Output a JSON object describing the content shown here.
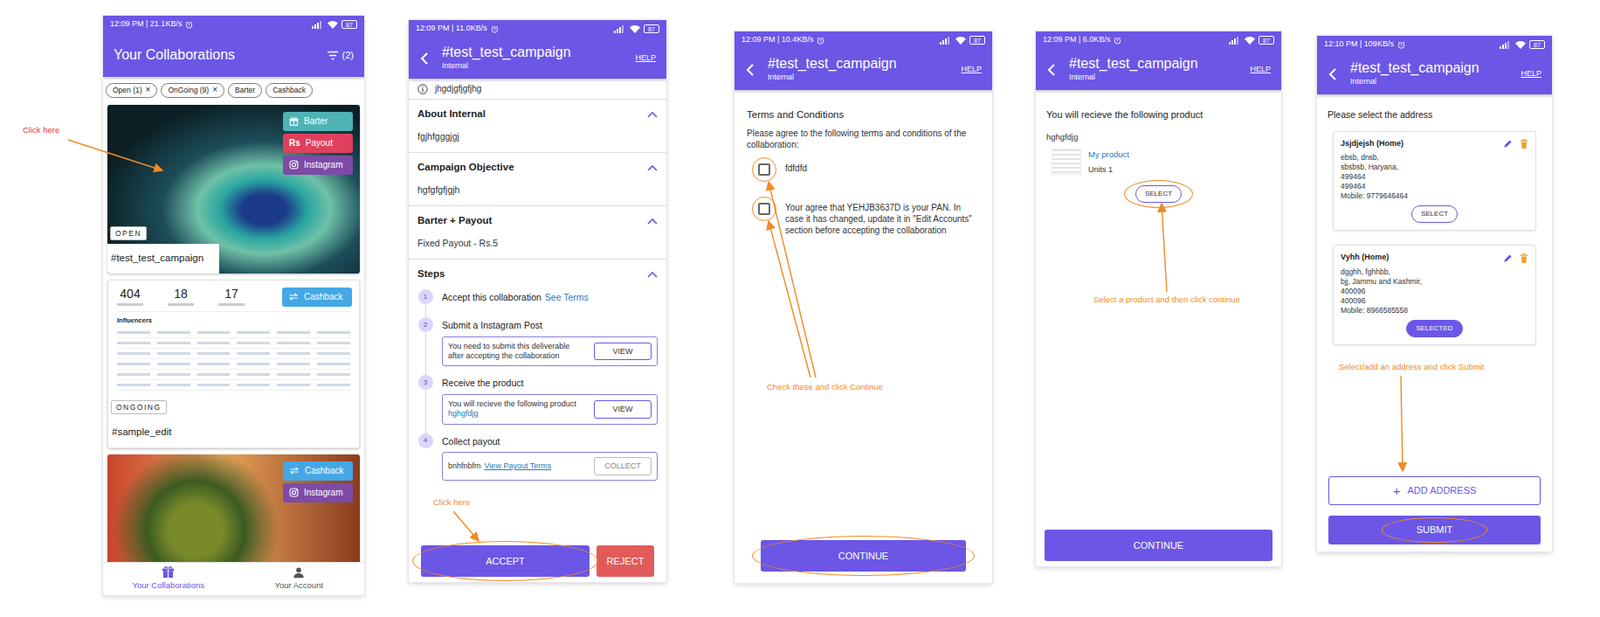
{
  "annotations": [
    {
      "text": "Click here",
      "color": "#e53935"
    },
    {
      "text": "Click here",
      "color": "#f08a24"
    },
    {
      "text": "Check these and click Continue",
      "color": "#f08a24"
    },
    {
      "text": "Select a product and then click continue",
      "color": "#f08a24"
    },
    {
      "text": "Select/add an address and click Submit",
      "color": "#f08a24"
    }
  ],
  "collaborations_screen": {
    "status_bar": {
      "time": "12:09 PM | 21.1KB/s",
      "battery": "87"
    },
    "title": "Your Collaborations",
    "filter_count": "(2)",
    "chip_remove": "×",
    "chips": [
      {
        "label": "Open (1)",
        "removable": true
      },
      {
        "label": "OnGoing (9)",
        "removable": true
      },
      {
        "label": "Barter",
        "removable": false
      },
      {
        "label": "Cashback",
        "removable": false
      }
    ],
    "cards": [
      {
        "kind": "feather-photo",
        "status": "OPEN",
        "title": "#test_test_campaign",
        "tags": [
          {
            "label": "Barter",
            "kind": "gift",
            "color": "#4fb3b5"
          },
          {
            "label": "Payout",
            "kind": "rupee",
            "glyph": "Rs",
            "color": "#e0405e"
          },
          {
            "label": "Instagram",
            "kind": "instagram",
            "color": "#7d4ba6"
          }
        ]
      },
      {
        "kind": "dashboard",
        "stats": [
          "404",
          "18",
          "17"
        ],
        "table_title": "Influencers",
        "status": "ONGOING",
        "title": "#sample_edit",
        "tags": [
          {
            "label": "Cashback",
            "kind": "cashback",
            "color": "#45a7e6"
          }
        ]
      },
      {
        "kind": "beetle-photo",
        "tags": [
          {
            "label": "Cashback",
            "kind": "cashback",
            "color": "#45a7e6"
          },
          {
            "label": "Instagram",
            "kind": "instagram",
            "color": "#7d4ba6"
          }
        ]
      }
    ],
    "nav": [
      {
        "label": "Your Collaborations",
        "selected": true
      },
      {
        "label": "Your Account",
        "selected": false
      }
    ]
  },
  "details_screen": {
    "status_bar": {
      "time": "12:09 PM | 11.0KB/s",
      "battery": "87"
    },
    "header": {
      "title": "#test_test_campaign",
      "subtitle": "Internal",
      "help": "HELP"
    },
    "info": "jhgdjgfjgfjhg",
    "sections": [
      {
        "title": "About Internal",
        "body": "fgjhfgggjgj",
        "expanded": true
      },
      {
        "title": "Campaign Objective",
        "body": "hgfgfgfjgjh",
        "expanded": true
      },
      {
        "title": "Barter + Payout",
        "body": "Fixed Payout - Rs.5",
        "expanded": true
      }
    ],
    "steps_title": "Steps",
    "steps_expanded": true,
    "steps": [
      {
        "kind": "accept",
        "number": "1",
        "title": "Accept this collaboration",
        "link": "See Terms"
      },
      {
        "kind": "deliverable",
        "number": "2",
        "title": "Submit a Instagram Post",
        "text": "You need to submit this deliverable after accepting the collaboration",
        "button": "VIEW",
        "disabled": false
      },
      {
        "kind": "product",
        "number": "3",
        "title": "Receive the product",
        "text": "You will recieve the following product",
        "link": "hghgfdjg",
        "button": "VIEW",
        "disabled": false
      },
      {
        "kind": "payout",
        "number": "4",
        "title": "Collect payout",
        "text": "bnhfnbfm",
        "link": "View Payout Terms",
        "button": "COLLECT",
        "disabled": true
      }
    ],
    "accept": "ACCEPT",
    "reject": "REJECT"
  },
  "terms_screen": {
    "status_bar": {
      "time": "12:09 PM | 10.4KB/s",
      "battery": "87"
    },
    "header": {
      "title": "#test_test_campaign",
      "subtitle": "Internal",
      "help": "HELP"
    },
    "title": "Terms and Conditions",
    "intro": "Please agree to the following terms and conditions of the collaboration:",
    "terms": [
      {
        "label": "fdfdfd",
        "checked": false
      },
      {
        "label": "Your agree that YEHJB3637D is your PAN. In case it has changed, update it in \"Edit Accounts\" section before accepting the collaboration",
        "checked": false
      }
    ],
    "button": "CONTINUE"
  },
  "product_screen": {
    "status_bar": {
      "time": "12:09 PM | 6.0KB/s",
      "battery": "87"
    },
    "header": {
      "title": "#test_test_campaign",
      "subtitle": "Internal",
      "help": "HELP"
    },
    "title": "You will recieve the following product",
    "subtitle": "hghgfdjg",
    "product": {
      "name": "My product",
      "units": "Units 1",
      "button": "SELECT",
      "selected": false
    },
    "button": "CONTINUE"
  },
  "address_screen": {
    "status_bar": {
      "time": "12:10 PM | 109KB/s",
      "battery": "87"
    },
    "header": {
      "title": "#test_test_campaign",
      "subtitle": "Internal",
      "help": "HELP"
    },
    "title": "Please select the address",
    "addresses": [
      {
        "name": "Jsjdjejsh (Home)",
        "lines": [
          "ebsb, dnsb,",
          "sbsbsb, Haryana,",
          "499464",
          "499464",
          "Mobile: 9779646464"
        ],
        "button": "SELECT",
        "selected": false
      },
      {
        "name": "Vyhh (Home)",
        "lines": [
          "dgghh, fghhbb,",
          "bjj, Jammu and Kashmir,",
          "400096",
          "400096",
          "Mobile: 8966585558"
        ],
        "button": "SELECTED",
        "selected": true
      }
    ],
    "add_icon": "+",
    "add": "ADD ADDRESS",
    "submit": "SUBMIT"
  }
}
